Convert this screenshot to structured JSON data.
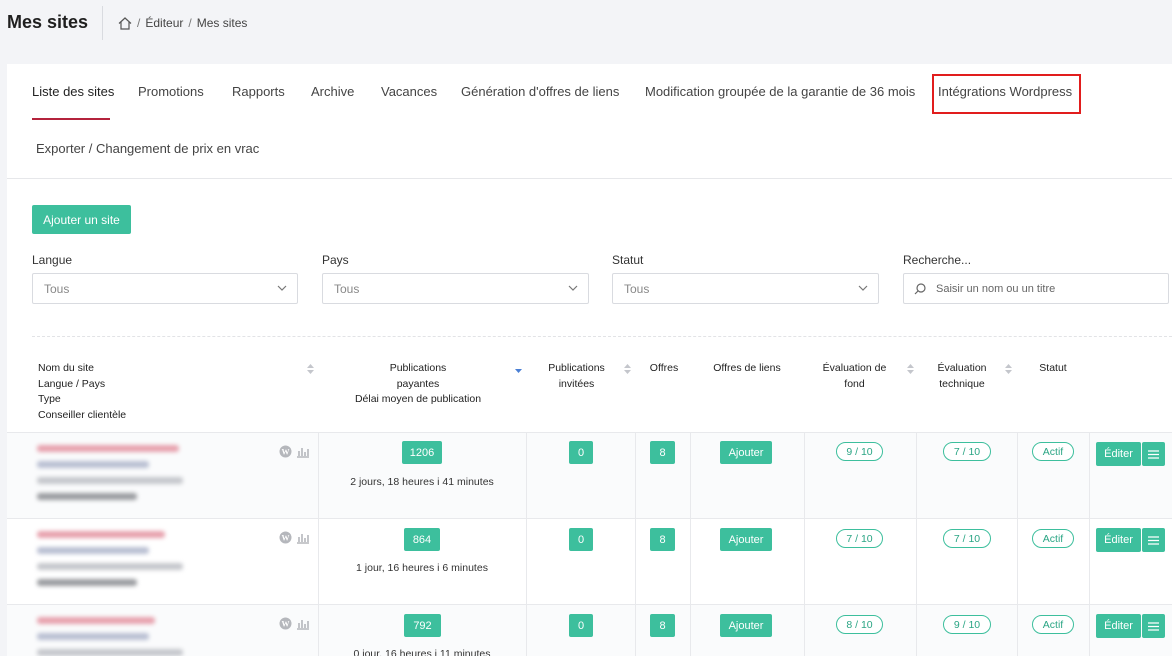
{
  "header": {
    "title": "Mes sites",
    "breadcrumb": [
      "Éditeur",
      "Mes sites"
    ]
  },
  "tabs": [
    {
      "label": "Liste des sites",
      "active": true
    },
    {
      "label": "Promotions"
    },
    {
      "label": "Rapports"
    },
    {
      "label": "Archive"
    },
    {
      "label": "Vacances"
    },
    {
      "label": "Génération d'offres de liens"
    },
    {
      "label": "Modification groupée de la garantie de 36 mois"
    },
    {
      "label": "Intégrations Wordpress"
    },
    {
      "label": "Exporter / Changement de prix en vrac"
    }
  ],
  "actions": {
    "add_site": "Ajouter un site"
  },
  "filters": {
    "langue": {
      "label": "Langue",
      "value": "Tous"
    },
    "pays": {
      "label": "Pays",
      "value": "Tous"
    },
    "statut": {
      "label": "Statut",
      "value": "Tous"
    },
    "recherche": {
      "label": "Recherche...",
      "placeholder": "Saisir un nom ou un titre"
    }
  },
  "table": {
    "columns": {
      "site_name": "Nom du site",
      "lang_country": "Langue / Pays",
      "type": "Type",
      "advisor": "Conseiller clientèle",
      "paid_pubs_1": "Publications",
      "paid_pubs_2": "payantes",
      "avg_delay": "Délai moyen de publication",
      "invited_1": "Publications",
      "invited_2": "invitées",
      "offers": "Offres",
      "link_offers": "Offres de liens",
      "eval_fond_1": "Évaluation de",
      "eval_fond_2": "fond",
      "eval_tech_1": "Évaluation",
      "eval_tech_2": "technique",
      "status": "Statut"
    },
    "rows": [
      {
        "paid": "1206",
        "delay": "2 jours, 18 heures i 41 minutes",
        "invited": "0",
        "offers": "8",
        "add": "Ajouter",
        "fond": "9 / 10",
        "tech": "7 / 10",
        "status": "Actif",
        "edit": "Éditer"
      },
      {
        "paid": "864",
        "delay": "1 jour, 16 heures i 6 minutes",
        "invited": "0",
        "offers": "8",
        "add": "Ajouter",
        "fond": "7 / 10",
        "tech": "7 / 10",
        "status": "Actif",
        "edit": "Éditer"
      },
      {
        "paid": "792",
        "delay": "0 jour, 16 heures i 11 minutes",
        "invited": "0",
        "offers": "8",
        "add": "Ajouter",
        "fond": "8 / 10",
        "tech": "9 / 10",
        "status": "Actif",
        "edit": "Éditer"
      }
    ]
  },
  "colors": {
    "accent": "#3dbf9d",
    "active_tab": "#b4233c",
    "highlight": "#e11d1d"
  }
}
